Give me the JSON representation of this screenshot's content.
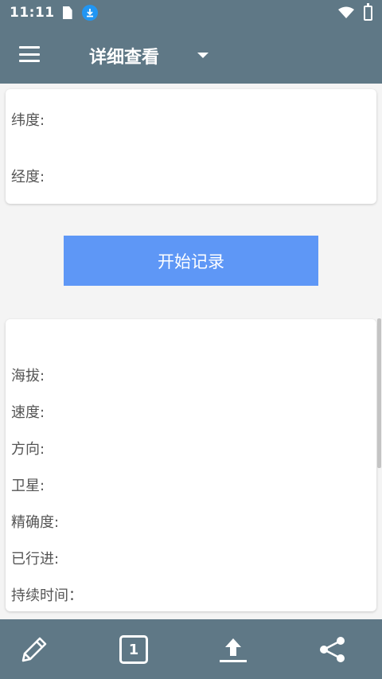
{
  "status_bar": {
    "time": "11:11"
  },
  "app_bar": {
    "title": "详细查看"
  },
  "location_card": {
    "latitude_label": "纬度:",
    "longitude_label": "经度:"
  },
  "start_button_label": "开始记录",
  "details_card": {
    "altitude_label": "海拔:",
    "speed_label": "速度:",
    "direction_label": "方向:",
    "satellite_label": "卫星:",
    "accuracy_label": "精确度:",
    "distance_label": "已行进:",
    "duration_label": "持续时间："
  },
  "bottom_bar": {
    "page_badge": "1"
  },
  "colors": {
    "primary": "#5f7886",
    "button": "#5e97f6",
    "download_icon": "#2196f3",
    "background": "#f4f4f4"
  },
  "icons": [
    "menu-icon",
    "dropdown-icon",
    "edit-icon",
    "page-badge-icon",
    "upload-icon",
    "share-icon",
    "wifi-icon",
    "battery-icon",
    "download-icon",
    "sim-card-icon"
  ]
}
